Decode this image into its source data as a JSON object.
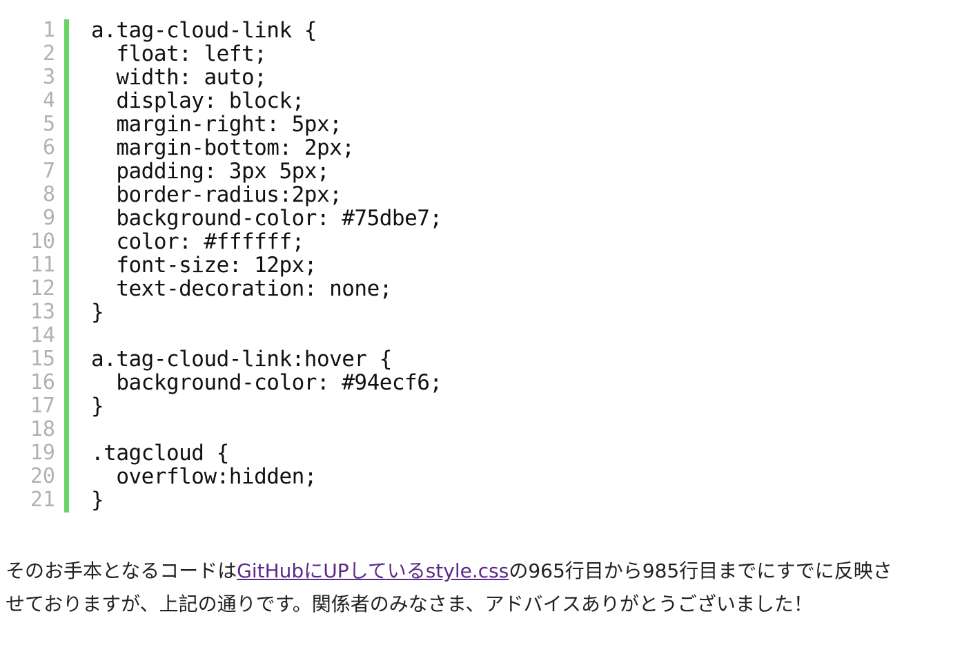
{
  "colors": {
    "gutter_bar": "#6ad46a",
    "line_number": "#b1b1b1",
    "code_text": "#111111",
    "link": "#5b2a86"
  },
  "code": {
    "lines": [
      "a.tag-cloud-link {",
      "  float: left;",
      "  width: auto;",
      "  display: block;",
      "  margin-right: 5px;",
      "  margin-bottom: 2px;",
      "  padding: 3px 5px;",
      "  border-radius:2px;",
      "  background-color: #75dbe7;",
      "  color: #ffffff;",
      "  font-size: 12px;",
      "  text-decoration: none;",
      "}",
      "",
      "a.tag-cloud-link:hover {",
      "  background-color: #94ecf6;",
      "}",
      "",
      ".tagcloud {",
      "  overflow:hidden;",
      "}"
    ]
  },
  "prose": {
    "before_link": "そのお手本となるコードは",
    "link_text": "GitHubにUPしているstyle.css",
    "after_link": "の965行目から985行目までにすでに反映させておりますが、上記の通りです。関係者のみなさま、アドバイスありがとうございました！"
  }
}
